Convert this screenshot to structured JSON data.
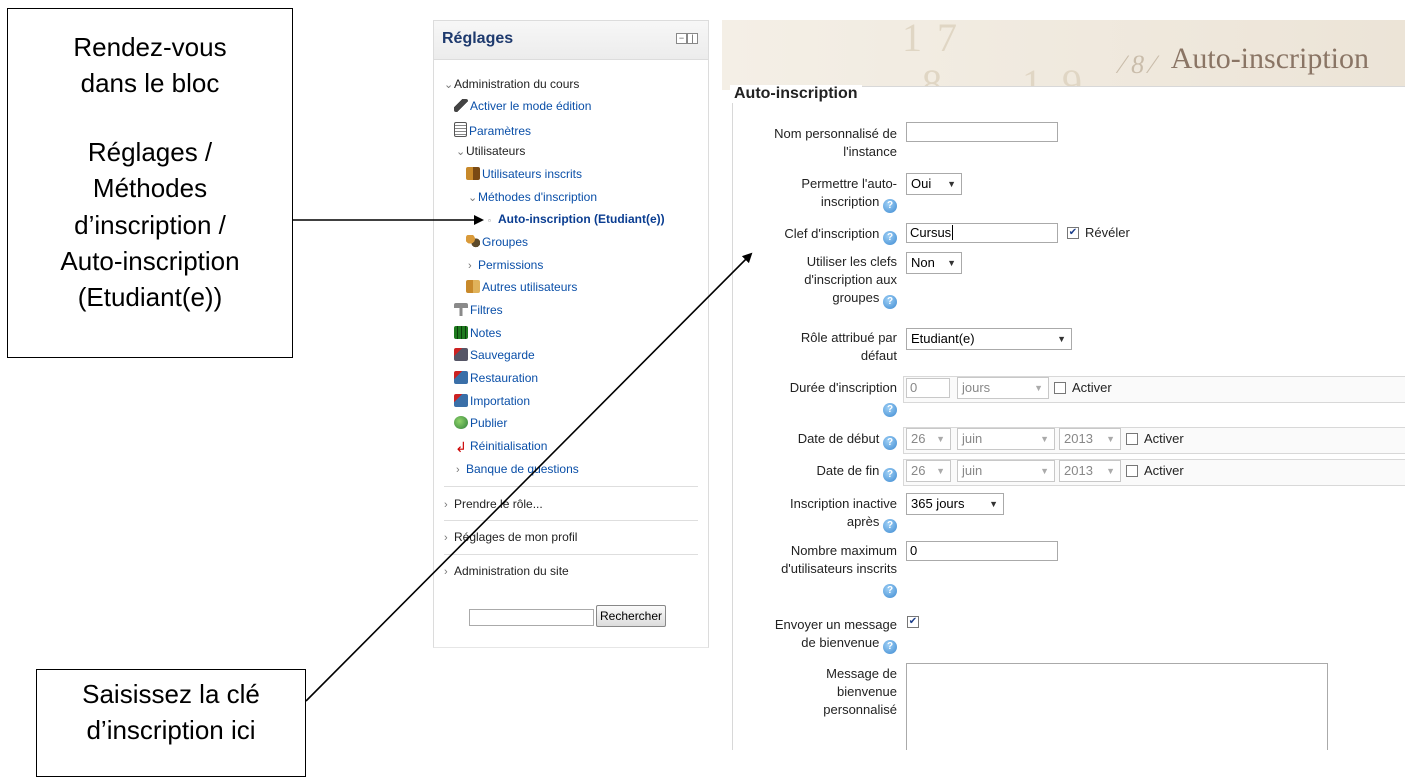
{
  "callouts": {
    "top": {
      "line1": "Rendez-vous",
      "line2": "dans le bloc",
      "line3": "Réglages /",
      "line4": "Méthodes",
      "line5": "d’inscription /",
      "line6": "Auto-inscription",
      "line7": "(Etudiant(e))"
    },
    "bottom": {
      "line1": "Saisissez la clé",
      "line2": "d’inscription ici"
    }
  },
  "settings": {
    "title": "Réglages",
    "tree": {
      "course_admin": "Administration du cours",
      "edit_mode": "Activer le mode édition",
      "parameters": "Paramètres",
      "users": "Utilisateurs",
      "enrolled_users": "Utilisateurs inscrits",
      "enrol_methods": "Méthodes d'inscription",
      "self_enrol": "Auto-inscription (Etudiant(e))",
      "groups": "Groupes",
      "permissions": "Permissions",
      "other_users": "Autres utilisateurs",
      "filters": "Filtres",
      "grades": "Notes",
      "backup": "Sauvegarde",
      "restore": "Restauration",
      "import": "Importation",
      "publish": "Publier",
      "reset": "Réinitialisation",
      "question_bank": "Banque de questions"
    },
    "switch_role": "Prendre le rôle...",
    "my_profile": "Réglages de mon profil",
    "site_admin": "Administration du site",
    "search_button": "Rechercher",
    "search_value": ""
  },
  "banner": {
    "title": "Auto-inscription"
  },
  "form": {
    "legend": "Auto-inscription",
    "custom_name": {
      "label_1": "Nom personnalisé de",
      "label_2": "l'instance",
      "value": ""
    },
    "allow_self": {
      "label_1": "Permettre l'auto-",
      "label_2": "inscription",
      "value": "Oui"
    },
    "enrol_key": {
      "label": "Clef d'inscription",
      "value": "Cursus",
      "reveal_label": "Révéler",
      "reveal_checked": true
    },
    "group_keys": {
      "label_1": "Utiliser les clefs",
      "label_2": "d'inscription aux",
      "label_3": "groupes",
      "value": "Non"
    },
    "default_role": {
      "label_1": "Rôle attribué par",
      "label_2": "défaut",
      "value": "Etudiant(e)"
    },
    "duration": {
      "label": "Durée d'inscription",
      "value": "0",
      "unit": "jours",
      "enable_label": "Activer"
    },
    "start_date": {
      "label": "Date de début",
      "day": "26",
      "month": "juin",
      "year": "2013",
      "enable_label": "Activer"
    },
    "end_date": {
      "label": "Date de fin",
      "day": "26",
      "month": "juin",
      "year": "2013",
      "enable_label": "Activer"
    },
    "inactive_after": {
      "label_1": "Inscription inactive",
      "label_2": "après",
      "value": "365 jours"
    },
    "max_users": {
      "label_1": "Nombre maximum",
      "label_2": "d'utilisateurs inscrits",
      "value": "0"
    },
    "welcome": {
      "label_1": "Envoyer un message",
      "label_2": "de bienvenue",
      "checked": true
    },
    "custom_message": {
      "label_1": "Message de",
      "label_2": "bienvenue",
      "label_3": "personnalisé",
      "value": ""
    }
  },
  "colors": {
    "link": "#0a4fa8",
    "settings_title": "#1e3a6e",
    "banner_bg": "#f4efe6",
    "banner_title": "#8a7565",
    "help_icon": "#3e8ad1"
  }
}
